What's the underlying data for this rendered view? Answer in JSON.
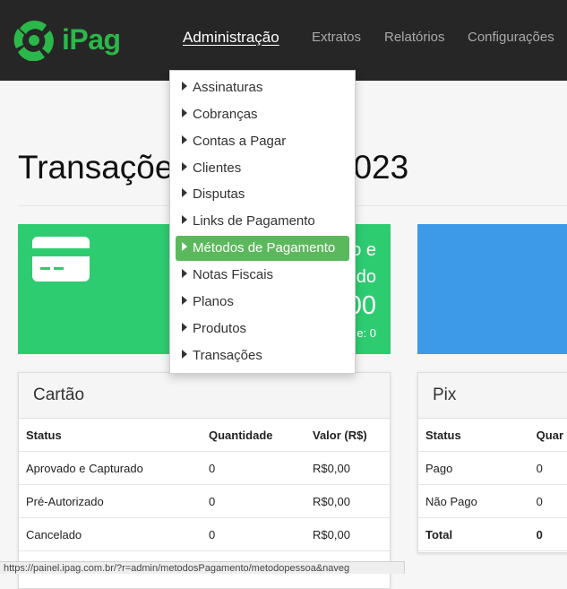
{
  "brand": {
    "name": "iPag",
    "color": "#2bb74a"
  },
  "nav": {
    "administracao": "Administração",
    "extratos": "Extratos",
    "relatorios": "Relatórios",
    "configuracoes": "Configurações"
  },
  "page": {
    "title_left": "Transaçõe",
    "title_right": "023"
  },
  "tiles": {
    "card": {
      "label_line1": "o e",
      "label_line2": "do",
      "value": "00",
      "sub": "e: 0",
      "color": "#2ecc71"
    },
    "pix": {
      "color": "#3d9ae8"
    }
  },
  "dropdown": {
    "items": [
      {
        "label": "Assinaturas"
      },
      {
        "label": "Cobranças"
      },
      {
        "label": "Contas a Pagar"
      },
      {
        "label": "Clientes"
      },
      {
        "label": "Disputas"
      },
      {
        "label": "Links de Pagamento"
      },
      {
        "label": "Métodos de Pagamento",
        "active": true
      },
      {
        "label": "Notas Fiscais"
      },
      {
        "label": "Planos"
      },
      {
        "label": "Produtos"
      },
      {
        "label": "Transações"
      }
    ]
  },
  "panels": {
    "card": {
      "title": "Cartão",
      "columns": [
        "Status",
        "Quantidade",
        "Valor (R$)"
      ],
      "rows": [
        [
          "Aprovado e Capturado",
          "0",
          "R$0,00"
        ],
        [
          "Pré-Autorizado",
          "0",
          "R$0,00"
        ],
        [
          "Cancelado",
          "0",
          "R$0,00"
        ]
      ]
    },
    "pix": {
      "title": "Pix",
      "columns": [
        "Status",
        "Quar"
      ],
      "rows": [
        [
          "Pago",
          "0"
        ],
        [
          "Não Pago",
          "0"
        ],
        [
          "Total",
          "0"
        ]
      ]
    }
  },
  "status_url": "https://painel.ipag.com.br/?r=admin/metodosPagamento/metodopessoa&naveg"
}
